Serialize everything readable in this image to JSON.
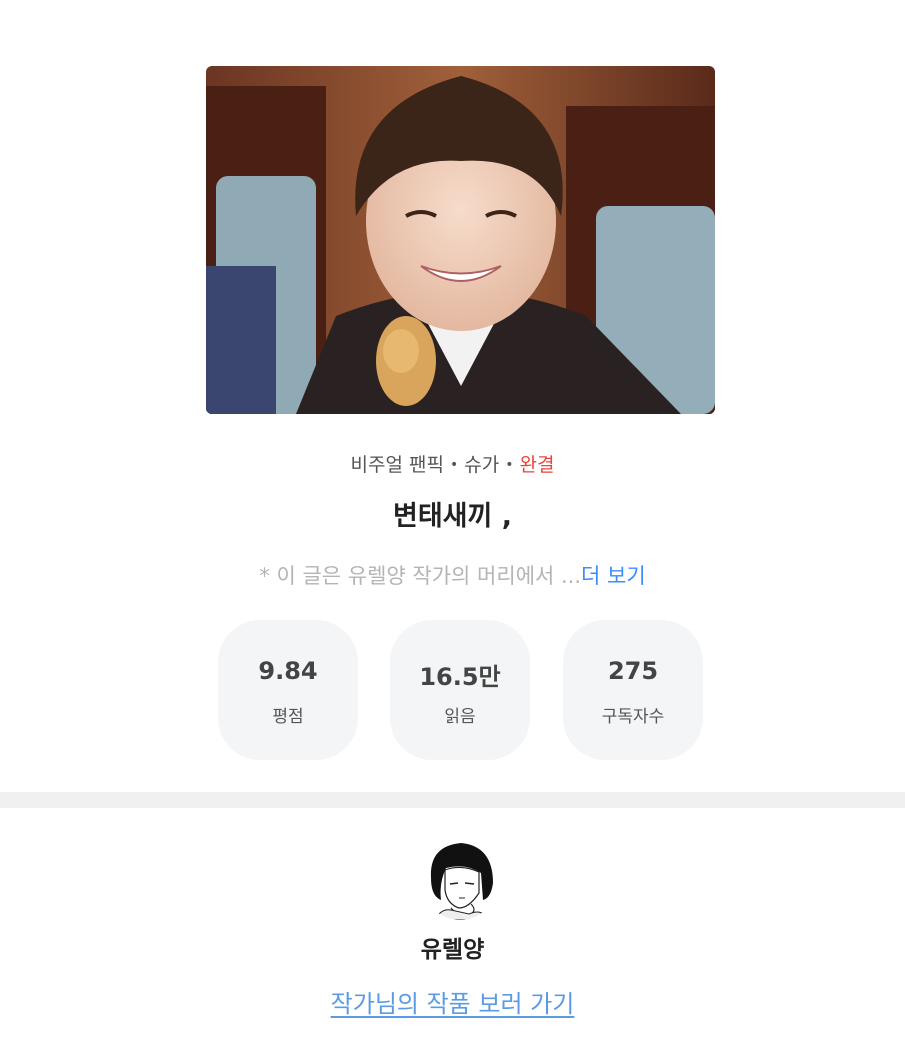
{
  "cover": {
    "icon": "cover-image"
  },
  "meta": {
    "category": "비주얼 팬픽",
    "character": "슈가",
    "status": "완결",
    "status_color": "#e8453c",
    "separator": "•"
  },
  "title": "변태새끼 ,",
  "description": {
    "text": "* 이 글은 유렐양 작가의 머리에서 ...",
    "more_label": "더 보기",
    "more_color": "#3d8cff"
  },
  "stats": [
    {
      "value": "9.84",
      "label": "평점"
    },
    {
      "value": "16.5만",
      "label": "읽음"
    },
    {
      "value": "275",
      "label": "구독자수"
    }
  ],
  "author": {
    "name": "유렐양",
    "avatar_icon": "author-avatar",
    "link_label": "작가님의 작품 보러 가기",
    "link_color": "#5b9be6"
  }
}
